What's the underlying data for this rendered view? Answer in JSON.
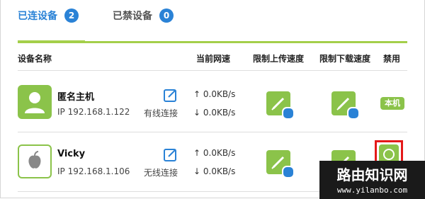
{
  "tabs": {
    "connected": {
      "label": "已连设备",
      "count": "2"
    },
    "banned": {
      "label": "已禁设备",
      "count": "0"
    }
  },
  "table": {
    "headers": {
      "device_name": "设备名称",
      "current_speed": "当前网速",
      "upload_limit": "限制上传速度",
      "download_limit": "限制下载速度",
      "disable": "禁用"
    },
    "rows": [
      {
        "name": "匿名主机",
        "ip": "IP 192.168.1.122",
        "connection": "有线连接",
        "upload_speed": "↑ 0.0KB/s",
        "download_speed": "↓ 0.0KB/s",
        "local_badge": "本机",
        "icon": "user-icon"
      },
      {
        "name": "Vicky",
        "ip": "IP 192.168.1.106",
        "connection": "无线连接",
        "upload_speed": "↑ 0.0KB/s",
        "download_speed": "↓ 0.0KB/s",
        "icon": "apple-icon"
      }
    ]
  },
  "watermark": {
    "title": "路由知识网",
    "url": "www.yilanbo.com"
  },
  "colors": {
    "accent": "#2a82d6",
    "green": "#8bc34a",
    "highlight": "#e41919"
  }
}
